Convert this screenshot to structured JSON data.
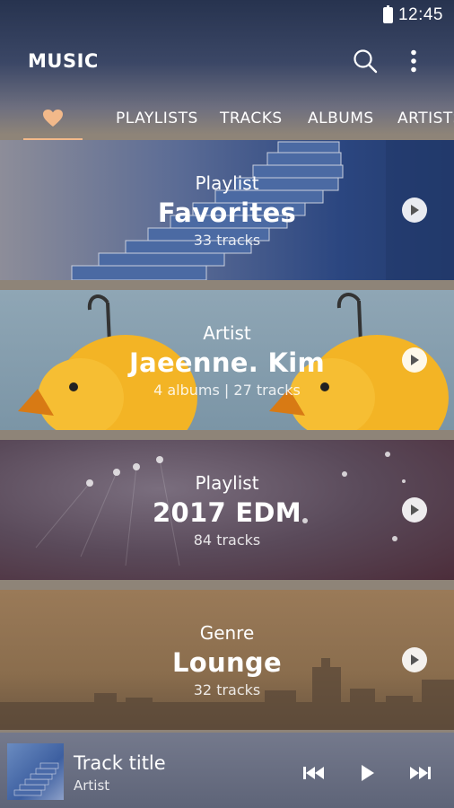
{
  "status_bar": {
    "time": "12:45"
  },
  "header": {
    "title": "MUSIC"
  },
  "tabs": [
    {
      "label": ""
    },
    {
      "label": "PLAYLISTS"
    },
    {
      "label": "TRACKS"
    },
    {
      "label": "ALBUMS"
    },
    {
      "label": "ARTISTS"
    }
  ],
  "cards": [
    {
      "kind": "Playlist",
      "name": "Favorites",
      "sub": "33 tracks"
    },
    {
      "kind": "Artist",
      "name": "Jaeenne. Kim",
      "sub": "4 albums | 27 tracks"
    },
    {
      "kind": "Playlist",
      "name": "2017 EDM",
      "sub": "84 tracks"
    },
    {
      "kind": "Genre",
      "name": "Lounge",
      "sub": "32 tracks"
    }
  ],
  "mini_player": {
    "title": "Track title",
    "artist": "Artist"
  },
  "colors": {
    "accent": "#f2b98a"
  }
}
